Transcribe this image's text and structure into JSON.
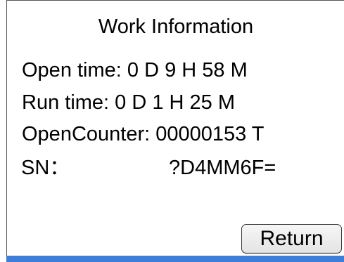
{
  "window": {
    "title": "Work Information"
  },
  "info": {
    "open_time": "Open time: 0 D 9 H 58 M",
    "run_time": "Run time: 0 D 1 H 25 M",
    "open_counter": "OpenCounter: 00000153 T",
    "sn_label": "SN：",
    "sn_value": "?D4MM6F="
  },
  "actions": {
    "return_label": "Return"
  },
  "colors": {
    "accent_bar": "#3c7ed9",
    "background": "#ffffff",
    "text": "#000000"
  }
}
